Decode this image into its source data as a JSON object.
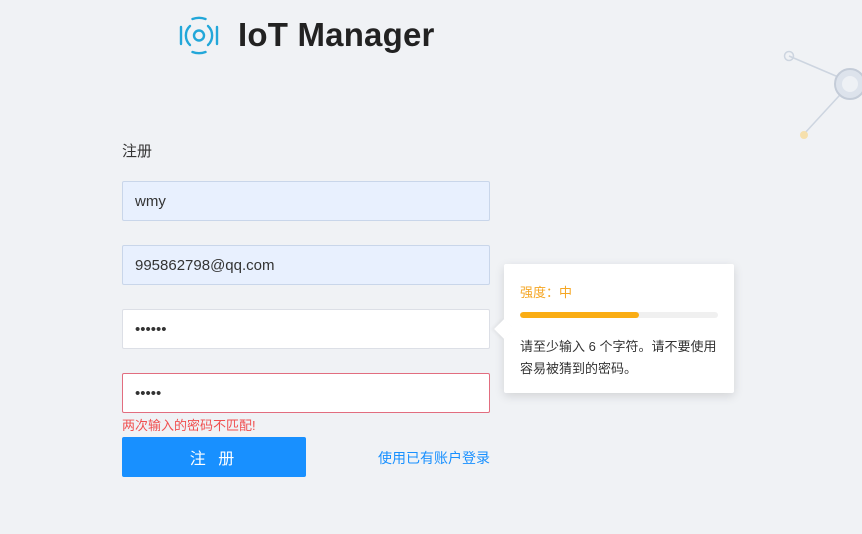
{
  "app": {
    "title": "IoT Manager",
    "logo_icon": "iot-signal-icon",
    "accent_color": "#1890ff",
    "logo_color": "#22a7d9"
  },
  "form": {
    "title": "注册",
    "username_value": "wmy",
    "email_value": "995862798@qq.com",
    "password_value": "••••••",
    "confirm_password_value": "•••••",
    "error_message": "两次输入的密码不匹配!",
    "submit_label": "注 册",
    "login_link_label": "使用已有账户登录"
  },
  "strength_popover": {
    "label": "强度：中",
    "level": 0.6,
    "hint": "请至少输入 6 个字符。请不要使用容易被猜到的密码。",
    "color": "#faad14"
  }
}
